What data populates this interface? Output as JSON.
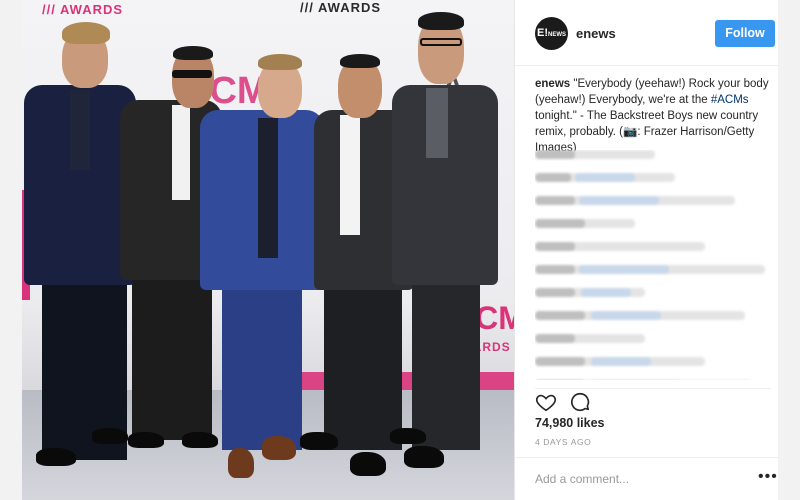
{
  "photo": {
    "backdrop": {
      "awards_left": "AWARDS",
      "awards_center": "AWARDS",
      "acm_center": "ACM",
      "acm_right": "ACM",
      "awards_right": "AWARDS",
      "awards_mark_glyph": "///"
    }
  },
  "post": {
    "avatar_text": "E!",
    "avatar_sub": "NEWS",
    "username": "enews",
    "follow_label": "Follow",
    "caption_user": "enews",
    "caption_text_1": " \"Everybody (yeehaw!) Rock your body (yeehaw!) Everybody, we're at the ",
    "caption_hashtag": "#ACMs",
    "caption_text_2": " tonight.\" - The Backstreet Boys new country remix, probably. (",
    "caption_camera": "📷",
    "caption_text_3": ": Frazer Harrison/Getty Images)",
    "likes": "74,980 likes",
    "timestamp": "4 DAYS AGO",
    "add_comment_placeholder": "Add a comment...",
    "more_label": "•••"
  },
  "colors": {
    "follow": "#3897f0",
    "hashtag": "#003569",
    "acm_pink": "#d9337a"
  },
  "icons": [
    "heart-icon",
    "comment-icon",
    "more-options-icon",
    "camera-emoji"
  ]
}
